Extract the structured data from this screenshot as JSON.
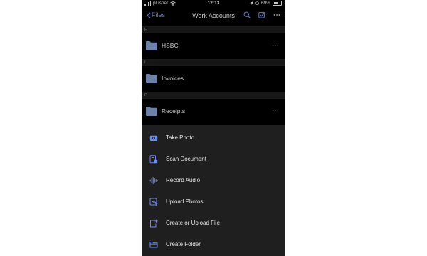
{
  "status_bar": {
    "carrier": "plusnet",
    "time": "12:13",
    "battery": "69%"
  },
  "nav": {
    "back_label": "Files",
    "title": "Work Accounts"
  },
  "sections": [
    {
      "letter": "H",
      "items": [
        {
          "name": "HSBC"
        }
      ]
    },
    {
      "letter": "I",
      "items": [
        {
          "name": "Invoices"
        }
      ]
    },
    {
      "letter": "R",
      "items": [
        {
          "name": "Receipts"
        }
      ]
    }
  ],
  "more_glyph": "···",
  "sheet": {
    "actions": [
      {
        "label": "Take Photo",
        "icon": "camera-icon"
      },
      {
        "label": "Scan Document",
        "icon": "scan-document-icon"
      },
      {
        "label": "Record Audio",
        "icon": "audio-waveform-icon"
      },
      {
        "label": "Upload Photos",
        "icon": "upload-photos-icon"
      },
      {
        "label": "Create or Upload File",
        "icon": "create-file-icon"
      },
      {
        "label": "Create Folder",
        "icon": "folder-outline-icon"
      }
    ]
  },
  "colors": {
    "accent": "#6d8cf0",
    "folder": "#7e9ac7",
    "sheet": "#1f1f1f",
    "section_header": "#1c1c1c"
  }
}
